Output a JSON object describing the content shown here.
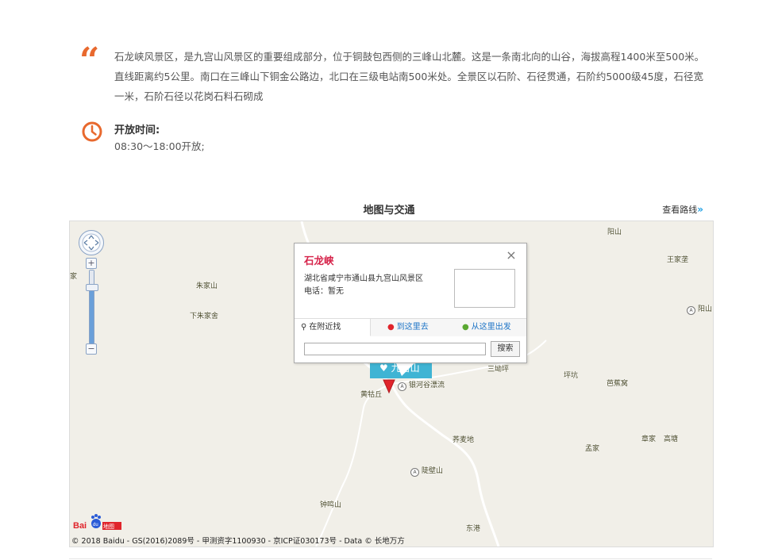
{
  "description": {
    "text": "石龙峡风景区，是九宫山风景区的重要组成部分，位于铜鼓包西侧的三峰山北麓。这是一条南北向的山谷，海拔高程1400米至500米。直线距离约5公里。南口在三峰山下铜金公路边，北口在三级电站南500米处。全景区以石阶、石径贯通，石阶约5000级45度，石径宽一米，石阶石径以花岗石料石砌成"
  },
  "hours": {
    "title": "开放时间:",
    "value": "08:30～18:00开放;"
  },
  "map_section": {
    "title": "地图与交通",
    "route_link": "查看路线",
    "route_arrow": "»"
  },
  "map": {
    "place_labels": [
      "阳山",
      "王家垄",
      "朱家山",
      "下朱家舍",
      "阳山",
      "三坳坪",
      "坪坑",
      "芭蕉窝",
      "黄牯丘",
      "银河谷漂流",
      "荞麦地",
      "孟家",
      "章家",
      "高塘",
      "陡壁山",
      "钟鸣山",
      "东港",
      "家"
    ],
    "marker_label": "九宫山",
    "popup": {
      "title": "石龙峡",
      "address": "湖北省咸宁市通山县九宫山风景区",
      "phone": "电话：暂无",
      "tabs": [
        "在附近找",
        "到这里去",
        "从这里出发"
      ],
      "search_placeholder": "",
      "search_button": "搜索",
      "close": "×"
    },
    "zoom_in": "+",
    "zoom_out": "−",
    "logo_text": "Bai du 地图",
    "copyright": "© 2018 Baidu - GS(2016)2089号 - 甲测资字1100930 - 京ICP证030173号 - Data © 长地万方"
  },
  "colors": {
    "accent_orange": "#e8692e",
    "link_blue": "#1b9ee3",
    "popup_title_red": "#d6234a",
    "marker_teal": "#3fb4d4",
    "map_bg": "#f1efe8"
  },
  "icons": {
    "quote": "quote-icon",
    "clock": "clock-icon",
    "route_arrow": "double-chevron-right-icon",
    "nav": "pan-control-icon",
    "close": "close-icon",
    "nearby": "magnifier-icon",
    "to_here": "pin-icon",
    "from_here": "pin-icon",
    "marker": "map-marker-icon",
    "heart": "heart-icon"
  }
}
